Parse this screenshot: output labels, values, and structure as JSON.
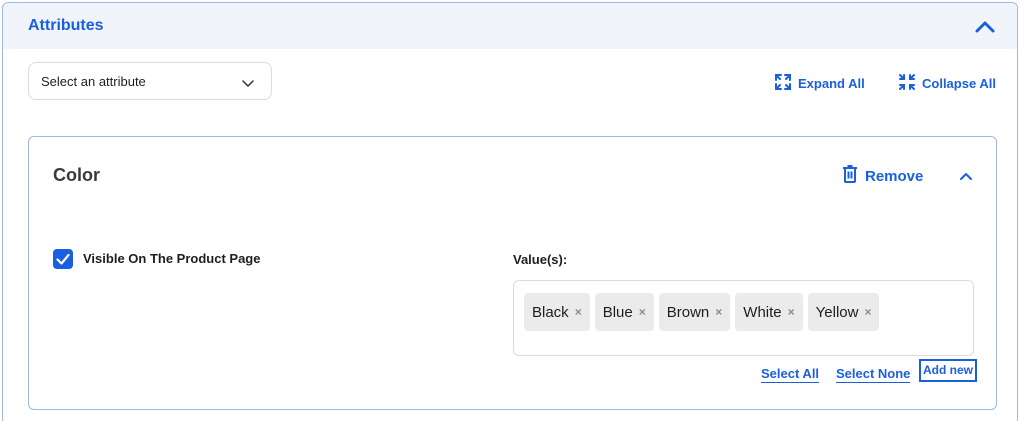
{
  "panel": {
    "title": "Attributes"
  },
  "attribute_select": {
    "placeholder": "Select an attribute"
  },
  "actions": {
    "expand_all": "Expand All",
    "collapse_all": "Collapse All"
  },
  "attribute": {
    "name": "Color",
    "remove_label": "Remove",
    "visible_label": "Visible On The Product Page",
    "visible_checked": true,
    "values_label": "Value(s):",
    "values": [
      "Black",
      "Blue",
      "Brown",
      "White",
      "Yellow"
    ],
    "select_all": "Select All",
    "select_none": "Select None",
    "add_new": "Add new"
  },
  "colors": {
    "accent": "#1a5fe0",
    "border": "#9db7ea",
    "header_bg": "#f1f5fb",
    "tag_bg": "#ebebeb"
  },
  "icons": {
    "panel_collapse": "chevron-up-icon",
    "select": "chevron-down-icon",
    "expand_all": "expand-icon",
    "collapse_all": "collapse-icon",
    "remove": "trash-icon",
    "card_collapse": "chevron-up-icon",
    "checkbox": "checkmark-icon",
    "tag_remove": "close-icon"
  }
}
